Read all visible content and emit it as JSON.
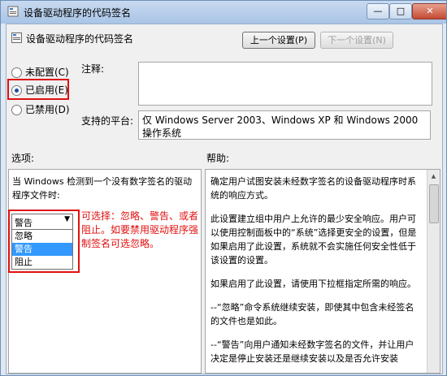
{
  "window": {
    "title": "设备驱动程序的代码签名",
    "controls": {
      "minimize": "—",
      "maximize": "□",
      "close": "✕"
    }
  },
  "header": {
    "policy_name": "设备驱动程序的代码签名",
    "prev_button": "上一个设置(P)",
    "next_button": "下一个设置(N)"
  },
  "state": {
    "options": [
      {
        "label": "未配置(C)",
        "checked": false
      },
      {
        "label": "已启用(E)",
        "checked": true
      },
      {
        "label": "已禁用(D)",
        "checked": false
      }
    ]
  },
  "comment": {
    "label": "注释:",
    "value": ""
  },
  "platform": {
    "label": "支持的平台:",
    "value": "仅 Windows Server 2003、Windows XP 和 Windows 2000 操作系统"
  },
  "options_panel": {
    "label": "选项:",
    "description": "当 Windows 检测到一个没有数字签名的驱动程序文件时:",
    "combo_value": "警告",
    "dropdown_items": [
      "忽略",
      "警告",
      "阻止"
    ],
    "selected_index": 1,
    "annotation": "可选择：忽略、警告、或者阻止。如要禁用驱动程序强制签名可选忽略。"
  },
  "help_panel": {
    "label": "帮助:",
    "paragraphs": [
      "确定用户试图安装未经数字签名的设备驱动程序时系统的响应方式。",
      "此设置建立组中用户上允许的最少安全响应。用户可以使用控制面板中的“系统”选择更安全的设置，但是如果启用了此设置，系统就不会实施任何安全性低于该设置的设置。",
      "如果启用了此设置，请使用下拉框指定所需的响应。",
      "--“忽略”命令系统继续安装，即使其中包含未经签名的文件也是如此。",
      "--“警告”向用户通知未经数字签名的文件，并让用户决定是停止安装还是继续安装以及是否允许安装"
    ]
  }
}
